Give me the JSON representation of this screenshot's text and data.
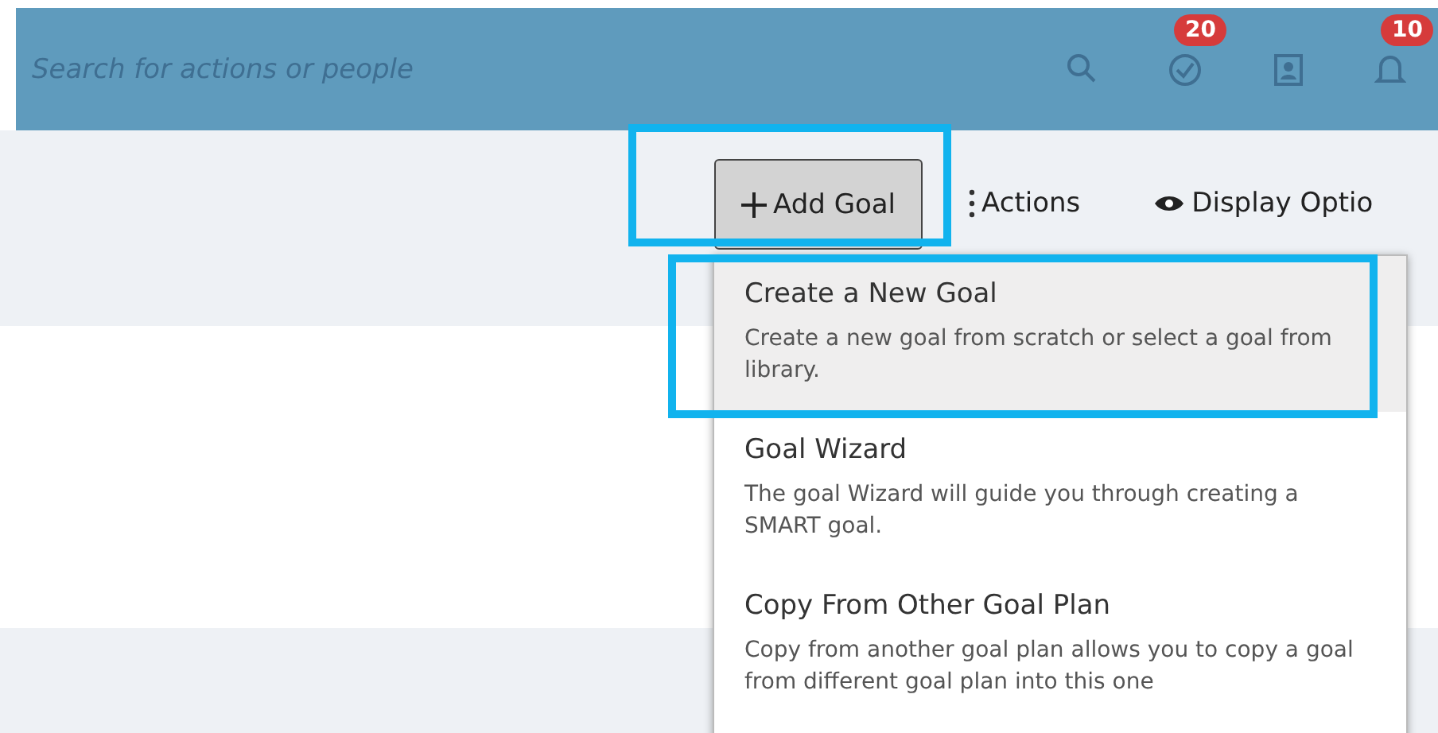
{
  "header": {
    "search": {
      "placeholder": "Search for actions or people"
    },
    "icons": [
      {
        "kind": "search"
      },
      {
        "kind": "check",
        "badge": "20"
      },
      {
        "kind": "contact"
      },
      {
        "kind": "bell",
        "badge": "10"
      }
    ]
  },
  "toolbar": {
    "buttons": [
      {
        "kind": "add",
        "label": "Add Goal",
        "selected": true,
        "highlighted": true
      },
      {
        "kind": "actions",
        "label": "Actions",
        "selected": false,
        "highlighted": false
      },
      {
        "kind": "display",
        "label": "Display Optio",
        "selected": false,
        "highlighted": false
      }
    ]
  },
  "menu": {
    "items": [
      {
        "title": "Create a New Goal",
        "description": "Create a new goal from scratch or select a goal from library.",
        "selected": true,
        "highlighted": true
      },
      {
        "title": "Goal Wizard",
        "description": "The goal Wizard will guide you through creating a SMART goal.",
        "selected": false,
        "highlighted": false
      },
      {
        "title": "Copy From Other Goal Plan",
        "description": "Copy from another goal plan allows you to copy a goal from different goal plan into this one",
        "selected": false,
        "highlighted": false
      }
    ]
  }
}
